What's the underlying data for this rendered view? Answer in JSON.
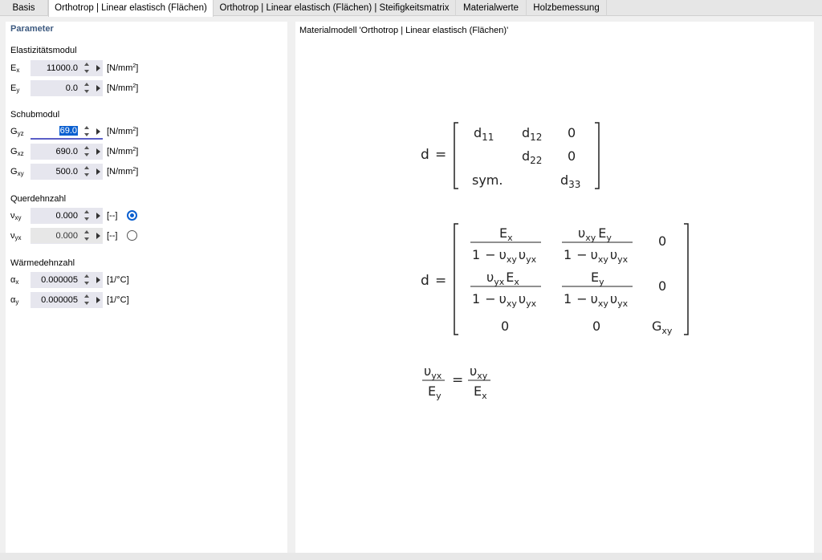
{
  "tabs": [
    {
      "label": "Basis",
      "active": false
    },
    {
      "label": "Orthotrop | Linear elastisch (Flächen)",
      "active": true
    },
    {
      "label": "Orthotrop | Linear elastisch (Flächen) | Steifigkeitsmatrix",
      "active": false
    },
    {
      "label": "Materialwerte",
      "active": false
    },
    {
      "label": "Holzbemessung",
      "active": false
    }
  ],
  "parameters": {
    "title": "Parameter",
    "elasticity": {
      "title": "Elastizitätsmodul",
      "ex": {
        "symbol": "E",
        "sub": "x",
        "value": "11000.0",
        "unit": "[N/mm",
        "unit_sup": "2",
        "unit_end": "]"
      },
      "ey": {
        "symbol": "E",
        "sub": "y",
        "value": "0.0",
        "unit": "[N/mm",
        "unit_sup": "2",
        "unit_end": "]"
      }
    },
    "shear": {
      "title": "Schubmodul",
      "gyz": {
        "symbol": "G",
        "sub": "yz",
        "value": "69.0",
        "unit": "[N/mm",
        "unit_sup": "2",
        "unit_end": "]"
      },
      "gxz": {
        "symbol": "G",
        "sub": "xz",
        "value": "690.0",
        "unit": "[N/mm",
        "unit_sup": "2",
        "unit_end": "]"
      },
      "gxy": {
        "symbol": "G",
        "sub": "xy",
        "value": "500.0",
        "unit": "[N/mm",
        "unit_sup": "2",
        "unit_end": "]"
      }
    },
    "poisson": {
      "title": "Querdehnzahl",
      "vxy": {
        "symbol": "ν",
        "sub": "xy",
        "value": "0.000",
        "unit": "[--]",
        "selected": true
      },
      "vyx": {
        "symbol": "ν",
        "sub": "yx",
        "value": "0.000",
        "unit": "[--]",
        "selected": false
      }
    },
    "thermal": {
      "title": "Wärmedehnzahl",
      "ax": {
        "symbol": "α",
        "sub": "x",
        "value": "0.000005",
        "unit": "[1/°C]"
      },
      "ay": {
        "symbol": "α",
        "sub": "y",
        "value": "0.000005",
        "unit": "[1/°C]"
      }
    }
  },
  "preview": {
    "caption": "Materialmodell 'Orthotrop | Linear elastisch (Flächen)'",
    "matrix1": {
      "lhs": "d",
      "eq": "=",
      "d11": "d",
      "d11_sub": "11",
      "d12": "d",
      "d12_sub": "12",
      "d13": "0",
      "d22": "d",
      "d22_sub": "22",
      "d23": "0",
      "sym": "sym.",
      "d33": "d",
      "d33_sub": "33"
    },
    "matrix2": {
      "lhs": "d",
      "eq": "=",
      "zero": "0",
      "one": "1",
      "minus": "−",
      "E": "E",
      "ups": "υ",
      "G": "G",
      "sx": "x",
      "sy": "y",
      "sxy": "xy",
      "syx": "yx"
    },
    "relation": {
      "ups": "υ",
      "E": "E",
      "sxy": "xy",
      "syx": "yx",
      "sx": "x",
      "sy": "y",
      "eq": "="
    }
  }
}
